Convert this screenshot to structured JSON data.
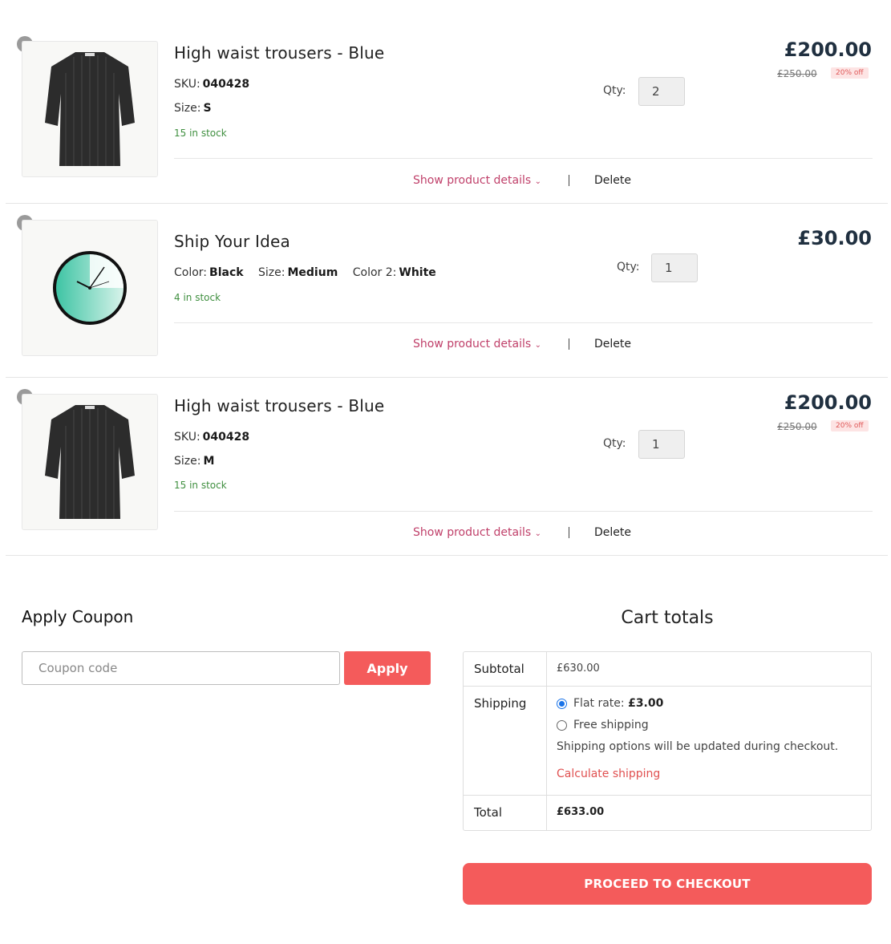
{
  "items": [
    {
      "name": "High waist trousers - Blue",
      "sku_label": "SKU:",
      "sku": "040428",
      "size_label": "Size:",
      "size": "S",
      "stock": "15 in stock",
      "qty_label": "Qty:",
      "qty": "2",
      "price": "£200.00",
      "old_price": "£250.00",
      "discount": "20% off",
      "details_label": "Show product details",
      "delete_label": "Delete",
      "image_icon": "dress-icon"
    },
    {
      "name": "Ship Your Idea",
      "color_label": "Color:",
      "color": "Black",
      "size_label": "Size:",
      "size": "Medium",
      "color2_label": "Color 2:",
      "color2": "White",
      "stock": "4 in stock",
      "qty_label": "Qty:",
      "qty": "1",
      "price": "£30.00",
      "details_label": "Show product details",
      "delete_label": "Delete",
      "image_icon": "clock-icon"
    },
    {
      "name": "High waist trousers - Blue",
      "sku_label": "SKU:",
      "sku": "040428",
      "size_label": "Size:",
      "size": "M",
      "stock": "15 in stock",
      "qty_label": "Qty:",
      "qty": "1",
      "price": "£200.00",
      "old_price": "£250.00",
      "discount": "20% off",
      "details_label": "Show product details",
      "delete_label": "Delete",
      "image_icon": "dress-icon"
    }
  ],
  "coupon": {
    "title": "Apply Coupon",
    "placeholder": "Coupon code",
    "apply_label": "Apply"
  },
  "totals": {
    "title": "Cart totals",
    "subtotal_label": "Subtotal",
    "subtotal": "£630.00",
    "shipping_label": "Shipping",
    "flat_rate_label": "Flat rate:",
    "flat_rate_value": "£3.00",
    "free_shipping_label": "Free shipping",
    "shipping_note": "Shipping options will be updated during checkout.",
    "calculate_label": "Calculate shipping",
    "total_label": "Total",
    "total": "£633.00",
    "checkout_label": "PROCEED TO CHECKOUT"
  },
  "colors": {
    "accent": "#f45b5b",
    "link": "#c0406a",
    "stock": "#3f8f3f",
    "price": "#203040"
  }
}
